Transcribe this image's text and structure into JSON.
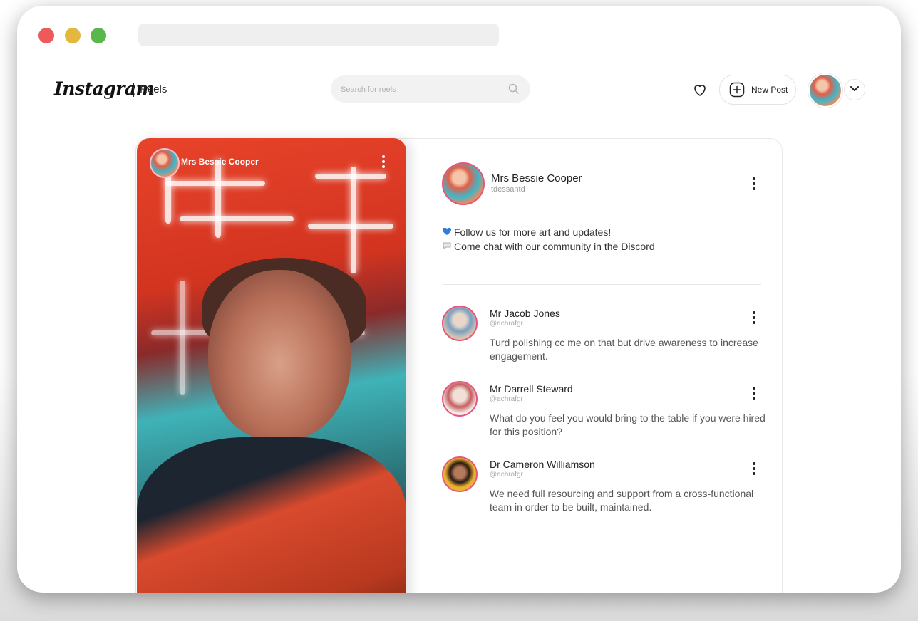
{
  "header": {
    "logo": "Instagram",
    "section": "Reels",
    "search_placeholder": "Search for reels",
    "new_post_label": "New Post"
  },
  "reel": {
    "author_name": "Mrs Bessie Cooper"
  },
  "post": {
    "author_name": "Mrs Bessie Cooper",
    "author_handle": "tdessantd",
    "bio": [
      {
        "icon": "blue-heart-icon",
        "text": "Follow us for more art and updates!"
      },
      {
        "icon": "speech-bubble-icon",
        "text": "Come chat with our community in the Discord"
      }
    ]
  },
  "comments": [
    {
      "name": "Mr Jacob Jones",
      "handle": "@achrafgr",
      "text": "Turd polishing cc me on that but drive awareness to increase engagement."
    },
    {
      "name": "Mr Darrell Steward",
      "handle": "@achrafgr",
      "text": "What do you feel you would bring to the table if you were hired for this position?"
    },
    {
      "name": "Dr Cameron Williamson",
      "handle": "@achrafgr",
      "text": "We need full resourcing and support from a cross-functional team in order to be built, maintained."
    }
  ],
  "colors": {
    "accent_ring": "#e8557a",
    "traffic_red": "#ee5a5a",
    "traffic_yellow": "#e2b83f",
    "traffic_green": "#59b84c"
  }
}
